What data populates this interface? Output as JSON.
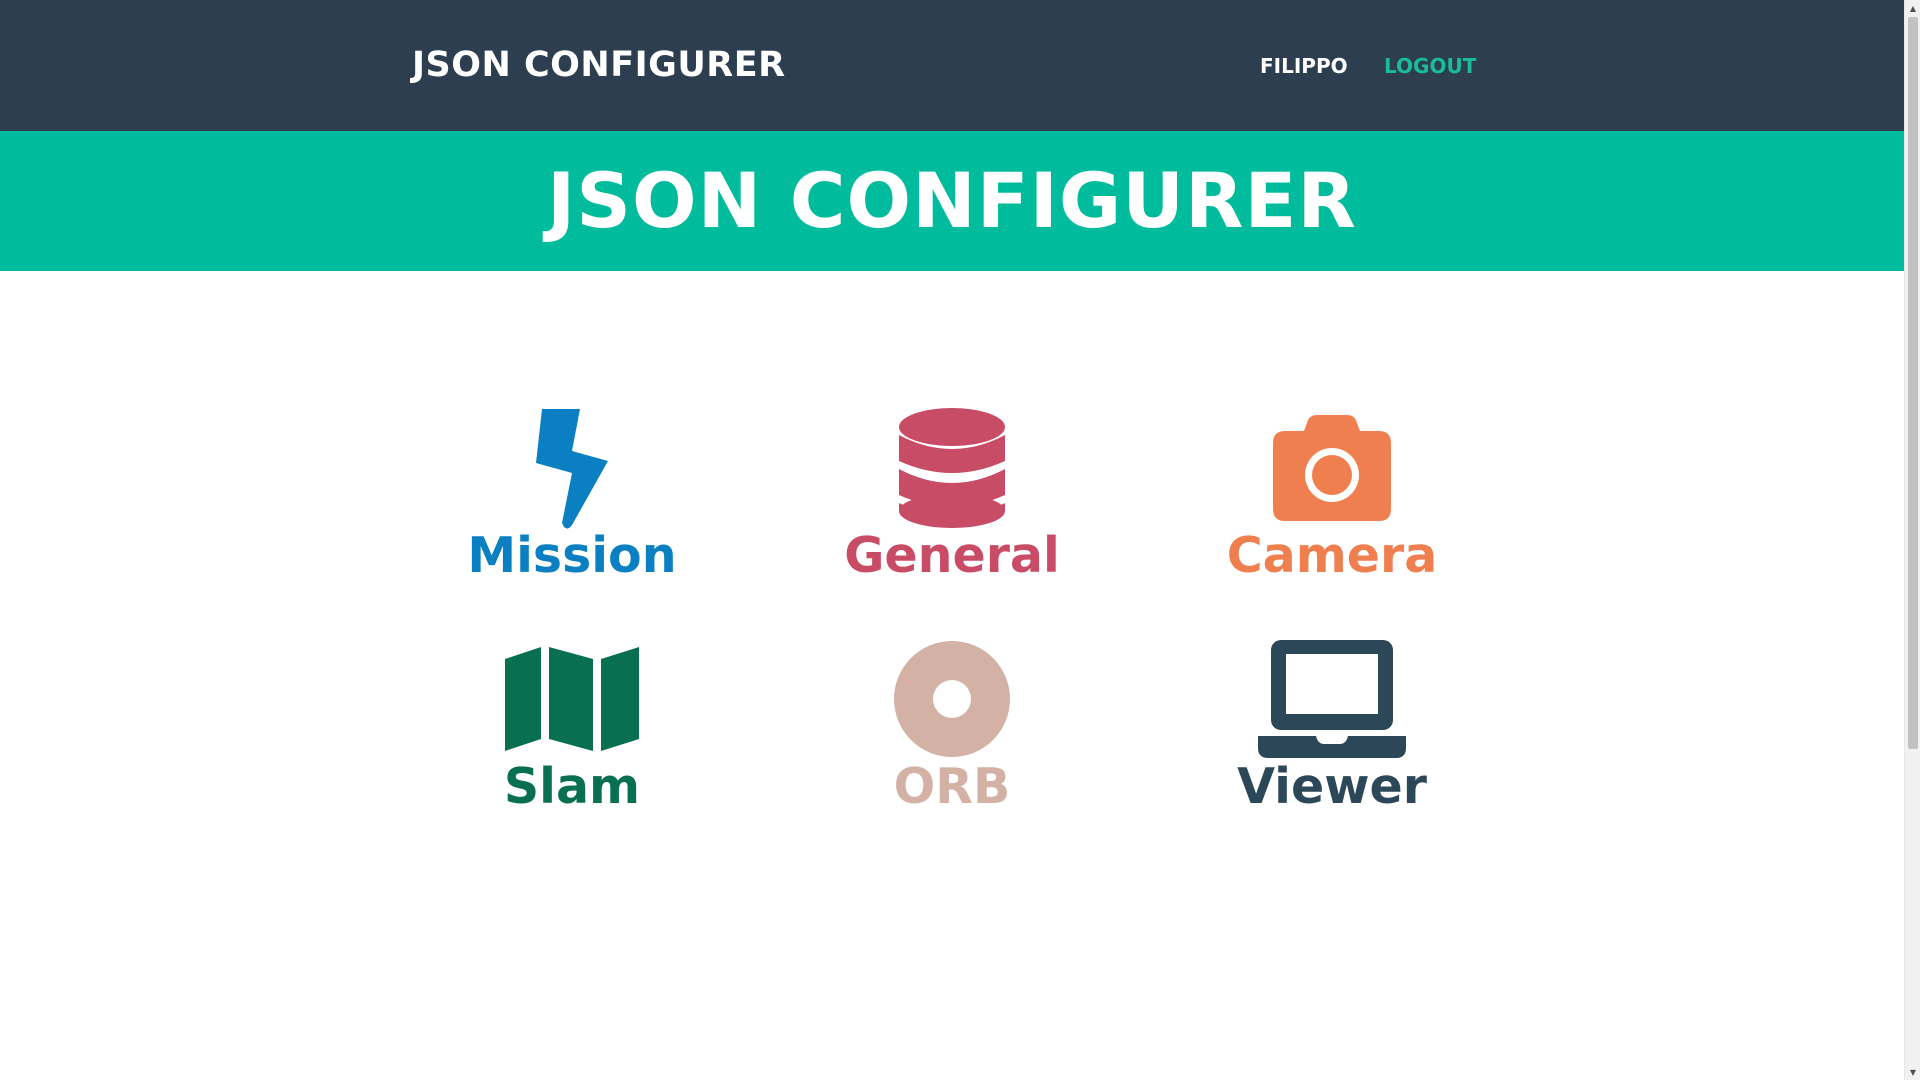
{
  "navbar": {
    "brand": "JSON CONFIGURER",
    "user": "FILIPPO",
    "logout": "LOGOUT"
  },
  "banner": {
    "title": "JSON CONFIGURER"
  },
  "tiles": [
    {
      "label": "Mission",
      "icon": "bolt-icon",
      "color": "#0a7fc1"
    },
    {
      "label": "General",
      "icon": "database-icon",
      "color": "#c94c66"
    },
    {
      "label": "Camera",
      "icon": "camera-icon",
      "color": "#f07f50"
    },
    {
      "label": "Slam",
      "icon": "map-icon",
      "color": "#087050"
    },
    {
      "label": "ORB",
      "icon": "dot-circle-icon",
      "color": "#d3b1a5"
    },
    {
      "label": "Viewer",
      "icon": "laptop-icon",
      "color": "#2c4858"
    }
  ],
  "colors": {
    "navbar": "#2c3e50",
    "banner": "#00bc9c",
    "accent": "#1abc9c"
  }
}
